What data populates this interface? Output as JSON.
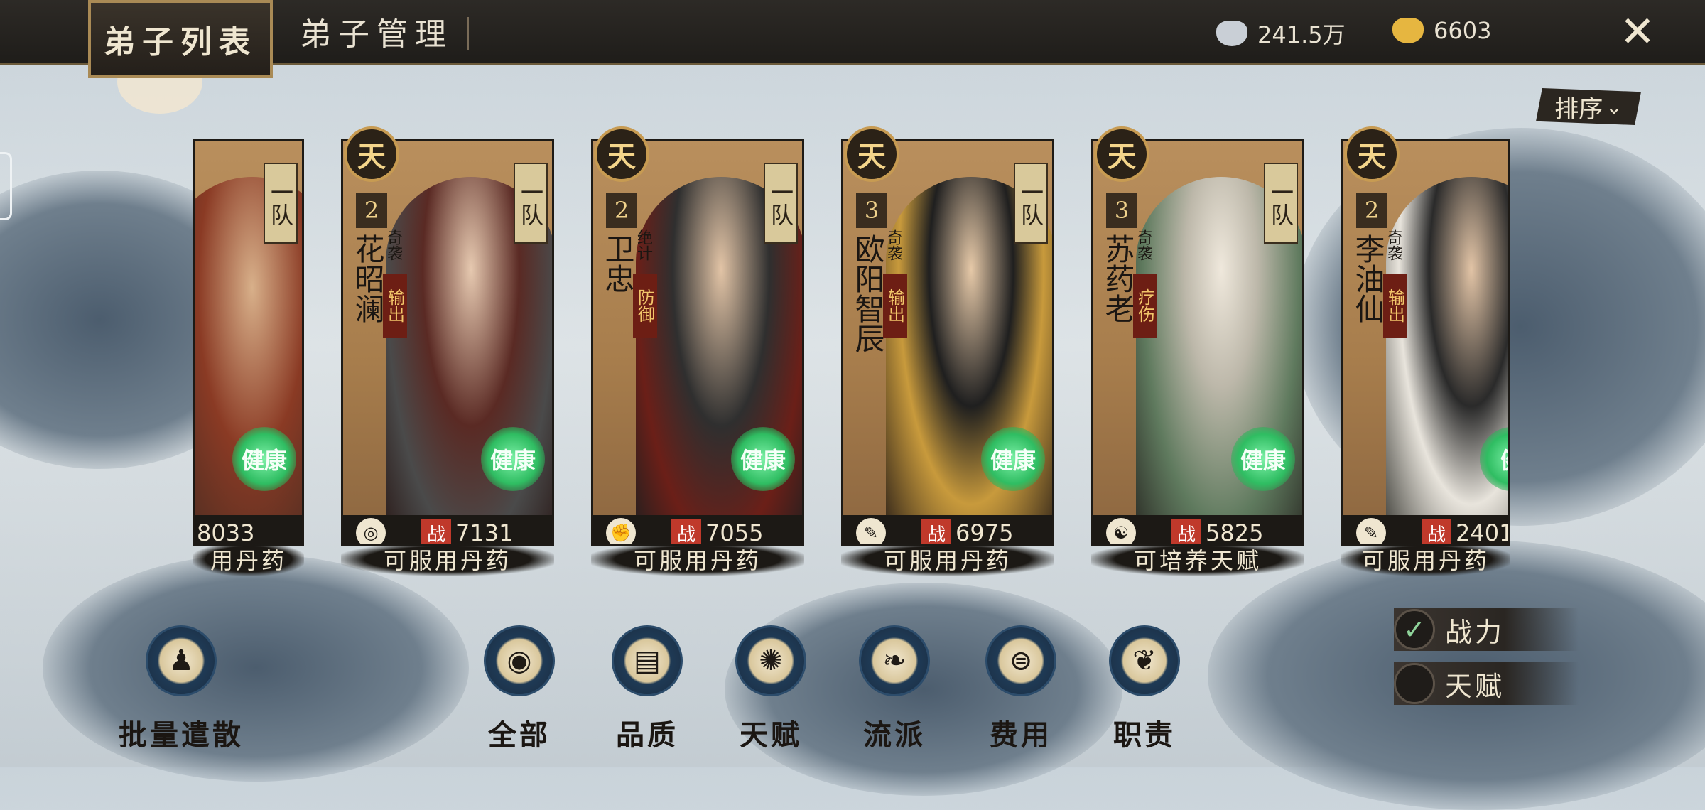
{
  "tabs": {
    "active": "弟子列表",
    "inactive": "弟子管理"
  },
  "currency": {
    "silver": "241.5万",
    "gold": "6603"
  },
  "sort_label": "排序",
  "cards": [
    {
      "name": "",
      "power": "8033",
      "status": "用丹药",
      "health": "健康"
    },
    {
      "rank_mark": "天",
      "star": "2",
      "team": "一队",
      "name": "花昭澜",
      "style": "奇袭",
      "role": "输出",
      "health": "健康",
      "power": "7131",
      "status": "可服用丹药",
      "zhan": "战"
    },
    {
      "rank_mark": "天",
      "star": "2",
      "team": "一队",
      "name": "卫忠",
      "style": "绝计",
      "role": "防御",
      "health": "健康",
      "power": "7055",
      "status": "可服用丹药",
      "zhan": "战"
    },
    {
      "rank_mark": "天",
      "star": "3",
      "team": "一队",
      "name": "欧阳智辰",
      "style": "奇袭",
      "role": "输出",
      "health": "健康",
      "power": "6975",
      "status": "可服用丹药",
      "zhan": "战"
    },
    {
      "rank_mark": "天",
      "star": "3",
      "team": "一队",
      "name": "苏药老",
      "style": "奇袭",
      "role": "疗伤",
      "health": "健康",
      "power": "5825",
      "status": "可培养天赋",
      "zhan": "战"
    },
    {
      "rank_mark": "天",
      "star": "2",
      "team": "",
      "name": "李油仙",
      "style": "奇袭",
      "role": "输出",
      "health": "健",
      "power": "2401",
      "status": "可服用丹药",
      "zhan": "战"
    }
  ],
  "nav": {
    "dismiss": "批量遣散",
    "all": "全部",
    "quality": "品质",
    "talent": "天赋",
    "school": "流派",
    "cost": "费用",
    "duty": "职责"
  },
  "sort_options": {
    "power": "战力",
    "talent": "天赋"
  }
}
